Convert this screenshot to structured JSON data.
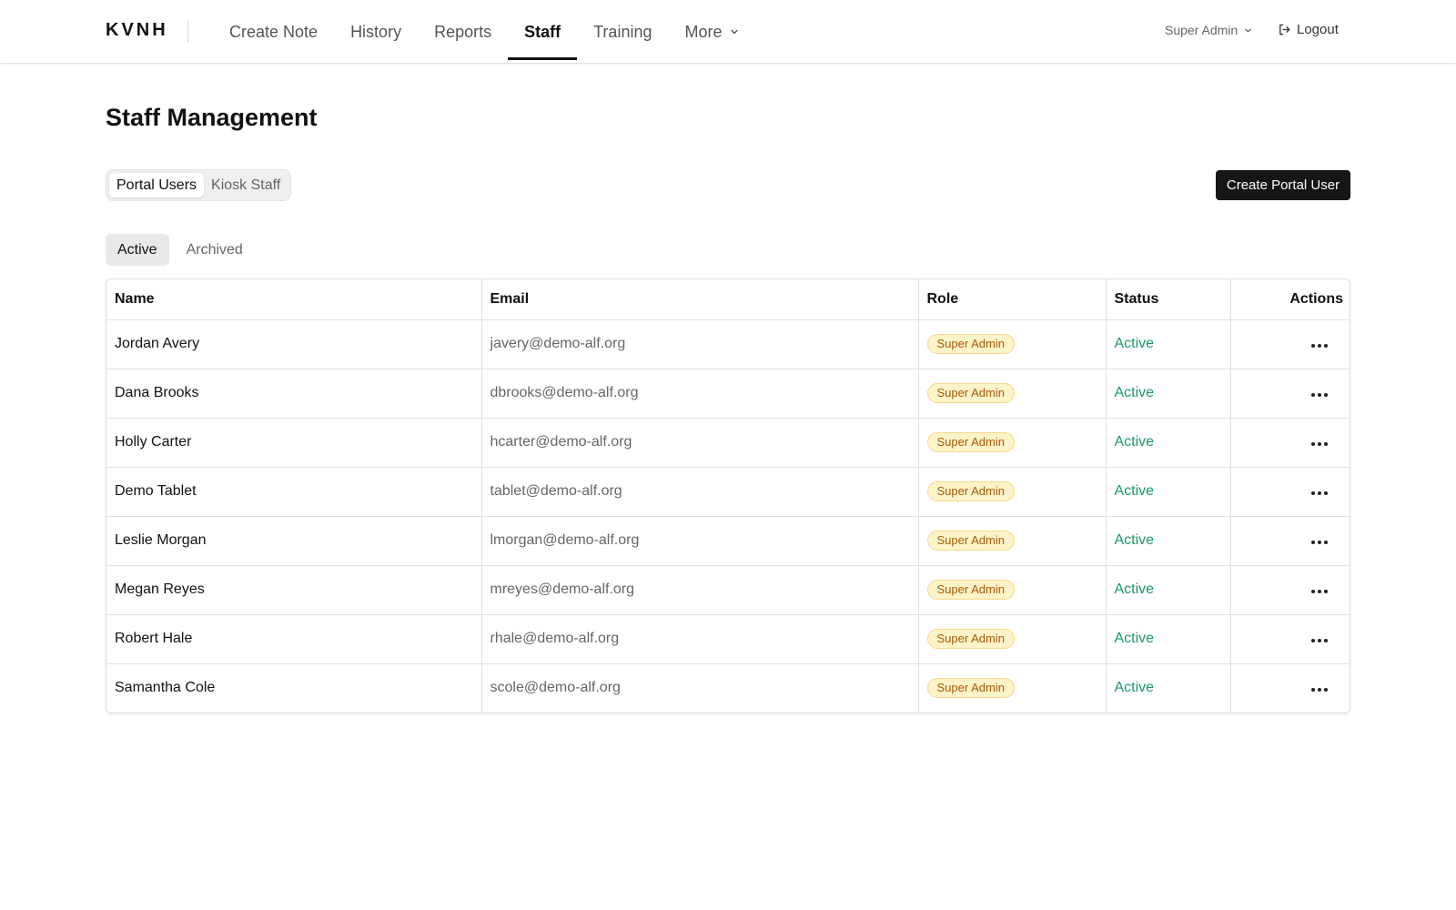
{
  "header": {
    "brand": "KVNH",
    "nav": [
      {
        "label": "Create Note",
        "active": false
      },
      {
        "label": "History",
        "active": false
      },
      {
        "label": "Reports",
        "active": false
      },
      {
        "label": "Staff",
        "active": true
      },
      {
        "label": "Training",
        "active": false
      },
      {
        "label": "More",
        "active": false,
        "icon": "chevron-down-icon"
      }
    ],
    "user_menu": {
      "label": "Super Admin",
      "icon": "chevron-down-icon"
    },
    "logout": {
      "label": "Logout",
      "icon": "logout-icon"
    }
  },
  "page": {
    "title": "Staff Management",
    "segments": [
      {
        "label": "Portal Users",
        "active": true
      },
      {
        "label": "Kiosk Staff",
        "active": false
      }
    ],
    "create_button": "Create Portal User",
    "filters": [
      {
        "label": "Active",
        "active": true
      },
      {
        "label": "Archived",
        "active": false
      }
    ]
  },
  "table": {
    "columns": [
      "Name",
      "Email",
      "Role",
      "Status",
      "Actions"
    ],
    "rows": [
      {
        "name": "Jordan Avery",
        "email": "javery@demo-alf.org",
        "role": "Super Admin",
        "status": "Active"
      },
      {
        "name": "Dana Brooks",
        "email": "dbrooks@demo-alf.org",
        "role": "Super Admin",
        "status": "Active"
      },
      {
        "name": "Holly Carter",
        "email": "hcarter@demo-alf.org",
        "role": "Super Admin",
        "status": "Active"
      },
      {
        "name": "Demo Tablet",
        "email": "tablet@demo-alf.org",
        "role": "Super Admin",
        "status": "Active"
      },
      {
        "name": "Leslie Morgan",
        "email": "lmorgan@demo-alf.org",
        "role": "Super Admin",
        "status": "Active"
      },
      {
        "name": "Megan Reyes",
        "email": "mreyes@demo-alf.org",
        "role": "Super Admin",
        "status": "Active"
      },
      {
        "name": "Robert Hale",
        "email": "rhale@demo-alf.org",
        "role": "Super Admin",
        "status": "Active"
      },
      {
        "name": "Samantha Cole",
        "email": "scole@demo-alf.org",
        "role": "Super Admin",
        "status": "Active"
      }
    ],
    "row_action_icon": "more-horizontal-icon"
  },
  "colors": {
    "accent": "#151515",
    "status_active": "#1a9a63",
    "badge_bg": "#fdf3c8",
    "badge_text": "#a65b06"
  }
}
